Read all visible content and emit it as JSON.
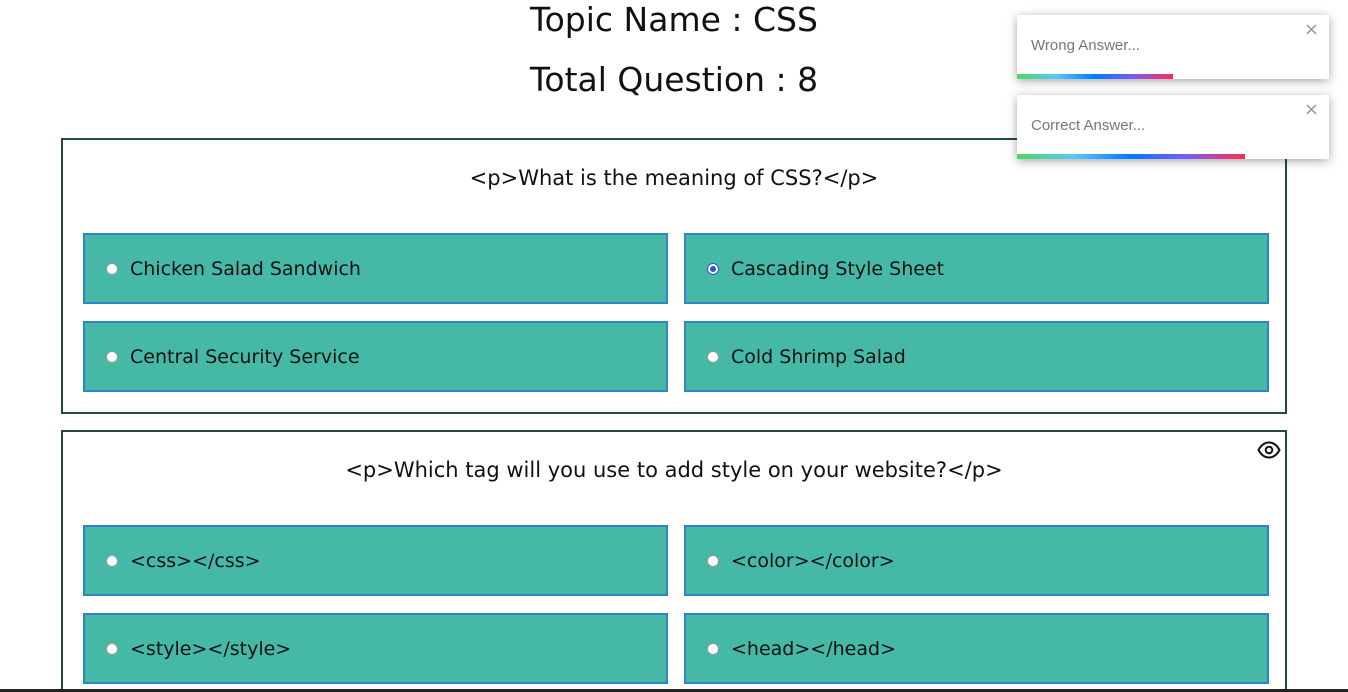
{
  "header": {
    "topic": "Topic Name : CSS",
    "total": "Total Question : 8"
  },
  "questions": [
    {
      "text": "<p>What is the meaning of CSS?</p>",
      "options": [
        {
          "label": "Chicken Salad Sandwich",
          "checked": false
        },
        {
          "label": "Cascading Style Sheet",
          "checked": true
        },
        {
          "label": "Central Security Service",
          "checked": false
        },
        {
          "label": "Cold Shrimp Salad",
          "checked": false
        }
      ]
    },
    {
      "text": "<p>Which tag will you use to add style on your website?</p>",
      "options": [
        {
          "label": "<css></css>",
          "checked": false
        },
        {
          "label": "<color></color>",
          "checked": false
        },
        {
          "label": "<style></style>",
          "checked": false
        },
        {
          "label": "<head></head>",
          "checked": false
        }
      ]
    }
  ],
  "toasts": [
    {
      "message": "Wrong Answer...",
      "close": "×",
      "progress": 0.5
    },
    {
      "message": "Correct Answer...",
      "close": "×",
      "progress": 0.73
    }
  ],
  "icons": {
    "eye": "eye-icon"
  },
  "colors": {
    "option_bg": "#45b8a6",
    "option_border": "#2f86c2",
    "card_border": "#1f4a48",
    "radio_checked": "#2b55c9"
  }
}
